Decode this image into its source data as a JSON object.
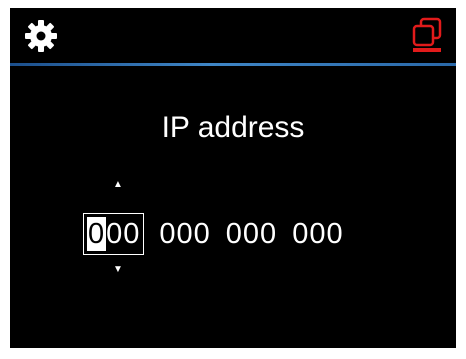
{
  "header": {
    "left_icon": "gear-icon",
    "right_icon": "window-stack-icon",
    "accent_color": "#e21b1b",
    "divider_color": "#3f86c6"
  },
  "main": {
    "title": "IP address",
    "ip": {
      "octets": [
        "000",
        "000",
        "000",
        "000"
      ],
      "active_octet_index": 0,
      "cursor_digit": "0",
      "active_rest": "00",
      "up_arrow": "▲",
      "down_arrow": "▼"
    }
  }
}
